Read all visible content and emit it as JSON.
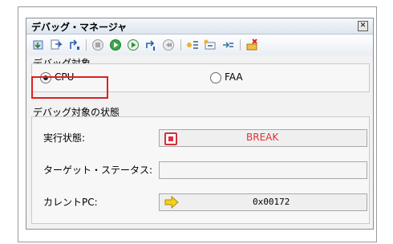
{
  "window": {
    "title": "デバッグ・マネージャ",
    "close_icon": "close-icon"
  },
  "toolbar": {
    "icons": [
      "download-icon",
      "step-into-icon",
      "return-icon",
      "stop-icon",
      "go-icon",
      "start-from-reset-icon",
      "step-over-icon",
      "step-back-icon",
      "bp-list-icon",
      "bp-add-icon",
      "bp-remove-icon",
      "clear-icon"
    ]
  },
  "debug_target": {
    "label": "デバッグ対象",
    "options": [
      {
        "label": "CPU",
        "selected": true
      },
      {
        "label": "FAA",
        "selected": false
      }
    ]
  },
  "target_state": {
    "label": "デバッグ対象の状態",
    "rows": [
      {
        "label": "実行状態:",
        "value": "BREAK",
        "icon": "break-icon"
      },
      {
        "label": "ターゲット・ステータス:",
        "value": ""
      },
      {
        "label": "カレントPC:",
        "value": "0x00172",
        "icon": "pc-arrow-icon"
      }
    ]
  },
  "colors": {
    "highlight": "#e02020",
    "break_text": "#e03030"
  }
}
